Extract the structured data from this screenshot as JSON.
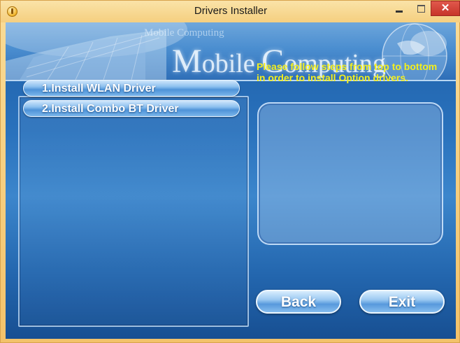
{
  "window": {
    "title": "Drivers Installer",
    "close_glyph": "✕"
  },
  "banner": {
    "small_text": "Mobile Computing",
    "big_text_cap1": "M",
    "big_text_rest1": "obile ",
    "big_text_cap2": "C",
    "big_text_rest2": "omputing"
  },
  "install_buttons": [
    {
      "label": "1.Install WLAN Driver"
    },
    {
      "label": "2.Install Combo BT Driver"
    }
  ],
  "instructions": "Please follow steps from top to bottom in order to install Option drivers.",
  "nav": {
    "back_label": "Back",
    "exit_label": "Exit"
  },
  "colors": {
    "accent_text": "#f4ef1c",
    "background_blue": "#2a72bd",
    "title_bar": "#f5cf7f"
  }
}
